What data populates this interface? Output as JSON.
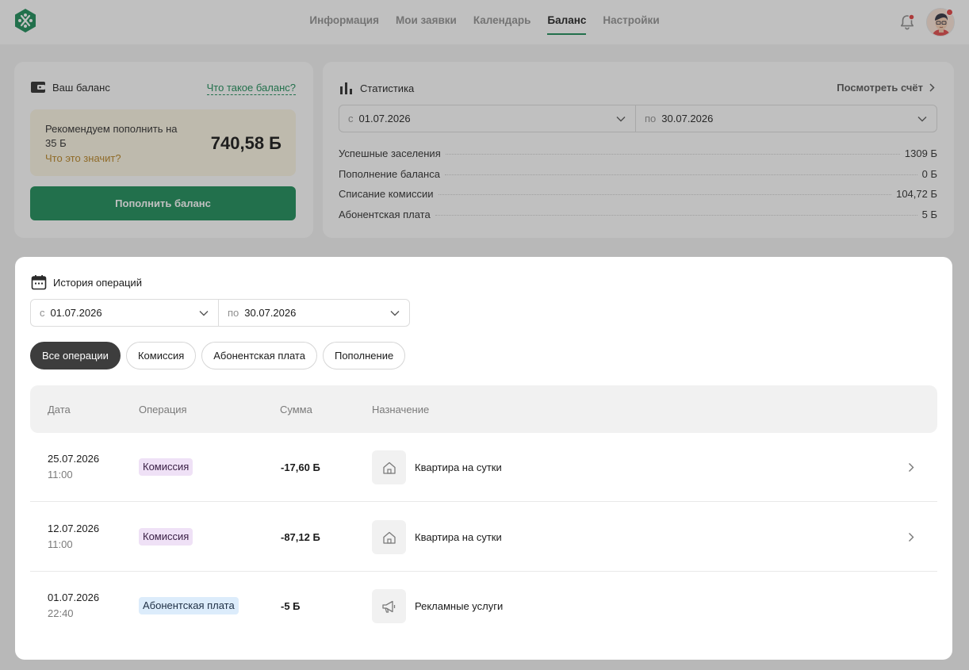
{
  "nav": {
    "items": [
      {
        "label": "Информация"
      },
      {
        "label": "Мои заявки"
      },
      {
        "label": "Календарь"
      },
      {
        "label": "Баланс"
      },
      {
        "label": "Настройки"
      }
    ],
    "active": "Баланс"
  },
  "balance": {
    "title": "Ваш баланс",
    "what_link": "Что такое баланс?",
    "recommend_text": "Рекомендуем пополнить на 35 Б",
    "recommend_link": "Что это значит?",
    "amount": "740,58 Б",
    "topup_button": "Пополнить баланс"
  },
  "stats": {
    "title": "Статистика",
    "view_bill": "Посмотреть счёт",
    "from_prefix": "с",
    "from_date": "01.07.2026",
    "to_prefix": "по",
    "to_date": "30.07.2026",
    "rows": [
      {
        "label": "Успешные заселения",
        "value": "1309 Б"
      },
      {
        "label": "Пополнение баланса",
        "value": "0 Б"
      },
      {
        "label": "Списание комиссии",
        "value": "104,72 Б"
      },
      {
        "label": "Абонентская плата",
        "value": "5 Б"
      }
    ]
  },
  "history": {
    "title": "История операций",
    "from_prefix": "с",
    "from_date": "01.07.2026",
    "to_prefix": "по",
    "to_date": "30.07.2026",
    "filters": [
      {
        "label": "Все операции",
        "active": true
      },
      {
        "label": "Комиссия",
        "active": false
      },
      {
        "label": "Абонентская плата",
        "active": false
      },
      {
        "label": "Пополнение",
        "active": false
      }
    ],
    "columns": {
      "date": "Дата",
      "operation": "Операция",
      "amount": "Сумма",
      "purpose": "Назначение"
    },
    "rows": [
      {
        "date": "25.07.2026",
        "time": "11:00",
        "operation": "Комиссия",
        "operation_color": "#efe1f6",
        "amount": "-17,60 Б",
        "purpose": "Квартира на сутки",
        "purpose_icon": "house-icon"
      },
      {
        "date": "12.07.2026",
        "time": "11:00",
        "operation": "Комиссия",
        "operation_color": "#efe1f6",
        "amount": "-87,12 Б",
        "purpose": "Квартира на сутки",
        "purpose_icon": "house-icon"
      },
      {
        "date": "01.07.2026",
        "time": "22:40",
        "operation": "Абонентская плата",
        "operation_color": "#dcecfb",
        "amount": "-5 Б",
        "purpose": "Рекламные услуги",
        "purpose_icon": "megaphone-icon"
      }
    ]
  },
  "colors": {
    "accent": "#178a54",
    "notification": "#e23b3b",
    "warning_text": "#b78220"
  }
}
